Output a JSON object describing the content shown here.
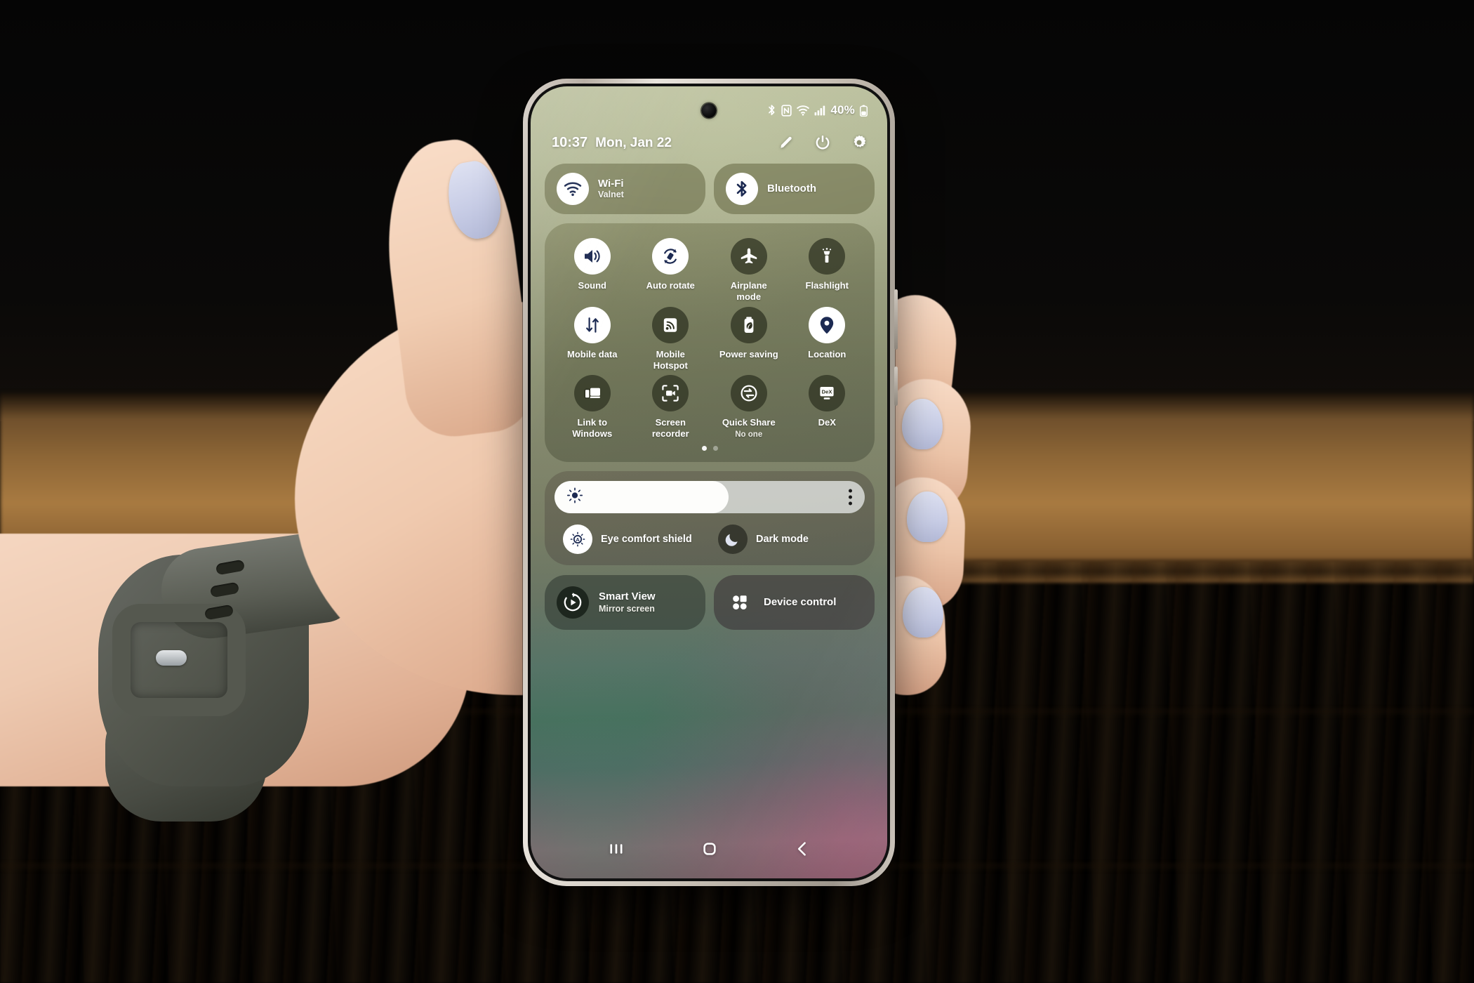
{
  "status_bar": {
    "icons": [
      "bluetooth-icon",
      "nfc-icon",
      "wifi-icon",
      "cellular-signal-icon"
    ],
    "battery_percent": "40%",
    "battery_icon": "battery-icon"
  },
  "header": {
    "time": "10:37",
    "date": "Mon, Jan 22",
    "actions": [
      {
        "name": "edit-pencil-icon",
        "label": "Edit"
      },
      {
        "name": "power-icon",
        "label": "Power"
      },
      {
        "name": "settings-gear-icon",
        "label": "Settings"
      }
    ]
  },
  "connectivity": [
    {
      "title": "Wi-Fi",
      "subtitle": "Valnet",
      "icon": "wifi-icon",
      "state": "on"
    },
    {
      "title": "Bluetooth",
      "subtitle": "",
      "icon": "bluetooth-icon",
      "state": "on"
    }
  ],
  "toggles": [
    {
      "label": "Sound",
      "sub": "",
      "icon": "sound-icon",
      "state": "on"
    },
    {
      "label": "Auto rotate",
      "sub": "",
      "icon": "auto-rotate-icon",
      "state": "on"
    },
    {
      "label": "Airplane mode",
      "sub": "",
      "icon": "airplane-icon",
      "state": "off"
    },
    {
      "label": "Flashlight",
      "sub": "",
      "icon": "flashlight-icon",
      "state": "off"
    },
    {
      "label": "Mobile data",
      "sub": "",
      "icon": "mobile-data-icon",
      "state": "on"
    },
    {
      "label": "Mobile Hotspot",
      "sub": "",
      "icon": "hotspot-icon",
      "state": "off"
    },
    {
      "label": "Power saving",
      "sub": "",
      "icon": "power-saving-icon",
      "state": "off"
    },
    {
      "label": "Location",
      "sub": "",
      "icon": "location-pin-icon",
      "state": "on"
    },
    {
      "label": "Link to Windows",
      "sub": "",
      "icon": "link-to-windows-icon",
      "state": "off"
    },
    {
      "label": "Screen recorder",
      "sub": "",
      "icon": "screen-recorder-icon",
      "state": "off"
    },
    {
      "label": "Quick Share",
      "sub": "No one",
      "icon": "quick-share-icon",
      "state": "off"
    },
    {
      "label": "DeX",
      "sub": "",
      "icon": "dex-icon",
      "state": "off"
    }
  ],
  "pager": {
    "pages": 2,
    "active": 1
  },
  "brightness": {
    "value_percent": 56,
    "slider_icon": "brightness-sun-icon",
    "menu_icon": "more-options-icon"
  },
  "display_modes": [
    {
      "label": "Eye comfort shield",
      "icon": "eye-comfort-icon",
      "state": "on"
    },
    {
      "label": "Dark mode",
      "icon": "moon-icon",
      "state": "off"
    }
  ],
  "bottom_tiles": [
    {
      "title": "Smart View",
      "subtitle": "Mirror screen",
      "icon": "smart-view-icon"
    },
    {
      "title": "Device control",
      "subtitle": "",
      "icon": "device-control-icon"
    }
  ],
  "navbar": [
    {
      "name": "recents-button",
      "icon": "recents-icon"
    },
    {
      "name": "home-button",
      "icon": "home-icon"
    },
    {
      "name": "back-button",
      "icon": "back-icon"
    }
  ],
  "colors": {
    "accent_dark_blue": "#1c2a52",
    "tile_on": "#ffffff",
    "tile_off": "#2d3020",
    "text": "#ffffff"
  }
}
